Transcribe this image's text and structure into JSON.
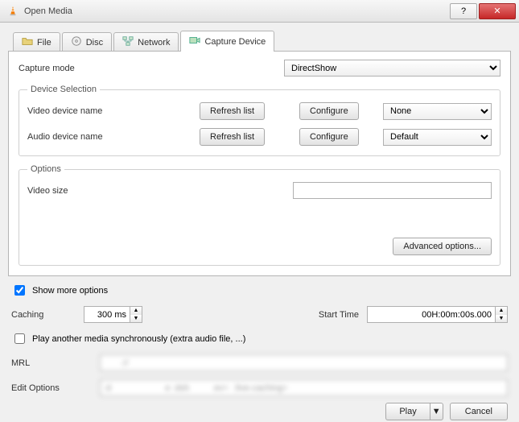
{
  "window": {
    "title": "Open Media",
    "help_label": "?",
    "close_label": "✕"
  },
  "tabs": {
    "file": "File",
    "disc": "Disc",
    "network": "Network",
    "capture": "Capture Device",
    "active": "capture"
  },
  "capture": {
    "mode_label": "Capture mode",
    "mode_value": "DirectShow",
    "device_legend": "Device Selection",
    "video_label": "Video device name",
    "audio_label": "Audio device name",
    "refresh_label": "Refresh list",
    "configure_label": "Configure",
    "video_value": "None",
    "audio_value": "Default",
    "options_legend": "Options",
    "video_size_label": "Video size",
    "video_size_value": "",
    "advanced_label": "Advanced options..."
  },
  "more": {
    "show_label": "Show more options",
    "show_checked": true,
    "caching_label": "Caching",
    "caching_value": "300 ms",
    "start_label": "Start Time",
    "start_value": "00H:00m:00s.000",
    "sync_label": "Play another media synchronously (extra audio file, ...)",
    "sync_checked": false,
    "mrl_label": "MRL",
    "mrl_value": "       ://",
    "edit_label": "Edit Options",
    "edit_value": ":d                      e :dsh          ev=  :live-caching="
  },
  "footer": {
    "play_label": "Play",
    "cancel_label": "Cancel"
  },
  "icons": {
    "vlc": "vlc-cone-icon",
    "folder": "folder-icon",
    "disc": "disc-icon",
    "network": "network-icon",
    "capture": "capture-icon",
    "updown": "▲▼",
    "dropdown": "▼"
  }
}
